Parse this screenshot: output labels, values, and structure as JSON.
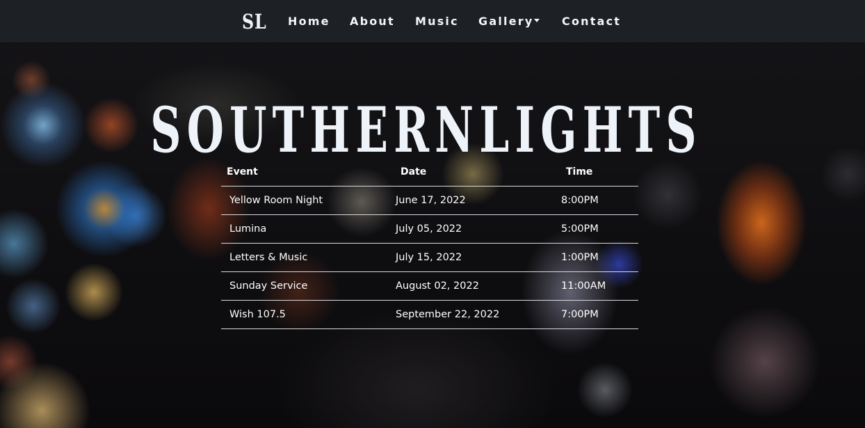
{
  "navbar": {
    "brand": "SL",
    "items": [
      {
        "label": "Home"
      },
      {
        "label": "About"
      },
      {
        "label": "Music"
      },
      {
        "label": "Gallery",
        "has_dropdown": true
      },
      {
        "label": "Contact"
      }
    ]
  },
  "hero": {
    "title": "SOUTHERNLIGHTS"
  },
  "events_table": {
    "headers": [
      "Event",
      "Date",
      "Time"
    ],
    "rows": [
      {
        "event": "Yellow Room Night",
        "date": "June 17, 2022",
        "time": "8:00PM"
      },
      {
        "event": "Lumina",
        "date": "July 05, 2022",
        "time": "5:00PM"
      },
      {
        "event": "Letters & Music",
        "date": "July 15, 2022",
        "time": "1:00PM"
      },
      {
        "event": "Sunday Service",
        "date": "August 02, 2022",
        "time": "11:00AM"
      },
      {
        "event": "Wish 107.5",
        "date": "September 22, 2022",
        "time": "7:00PM"
      }
    ]
  },
  "colors": {
    "navbar_bg": "#1e2126",
    "text": "#ffffff",
    "title": "#eef3fa",
    "table_rule": "#d8dadd"
  }
}
